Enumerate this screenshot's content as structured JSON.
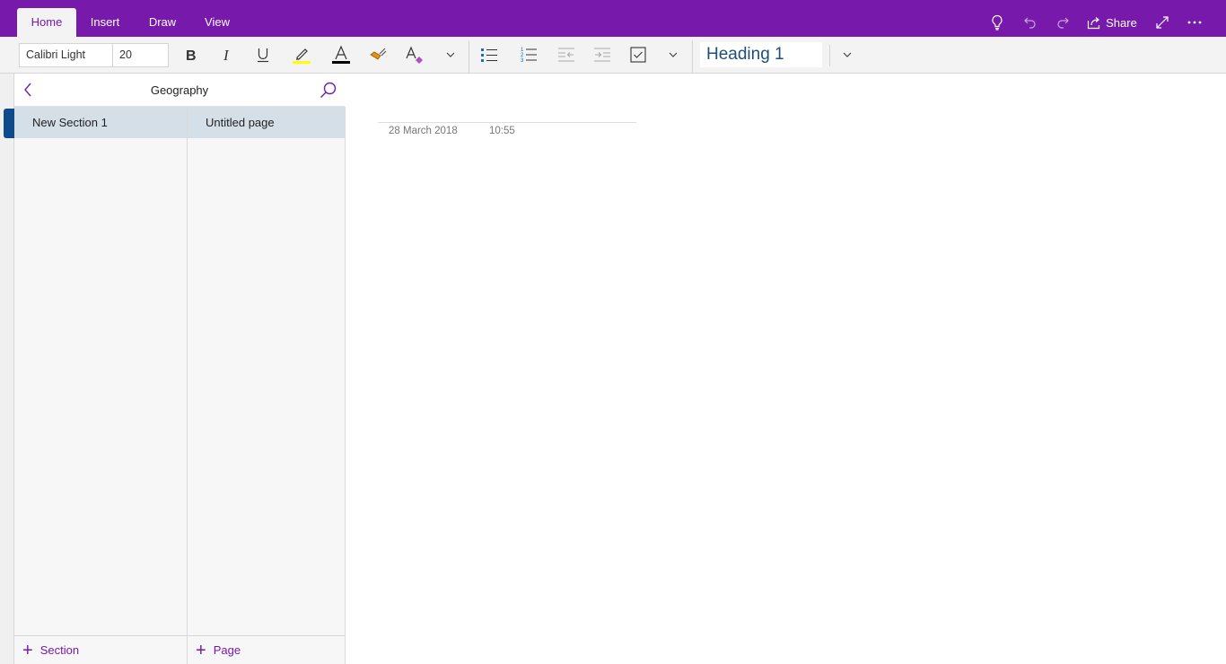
{
  "app": {
    "accent_color": "#7719aa",
    "selected_item_color": "#d5dfe8",
    "section_indicator_color": "#0f4a8a"
  },
  "tabs": [
    {
      "label": "Home",
      "active": true
    },
    {
      "label": "Insert",
      "active": false
    },
    {
      "label": "Draw",
      "active": false
    },
    {
      "label": "View",
      "active": false
    }
  ],
  "titlebar_actions": {
    "tell_me_icon": "lightbulb-icon",
    "undo_icon": "undo-icon",
    "redo_icon": "redo-icon",
    "share_label": "Share",
    "fullscreen_icon": "expand-icon",
    "more_icon": "more-icon"
  },
  "ribbon": {
    "font_name": "Calibri Light",
    "font_size": "20",
    "highlight_color": "#ffff00",
    "font_color": "#000000",
    "paragraph_style": "Heading 1",
    "buttons": [
      "bold",
      "italic",
      "underline",
      "highlight",
      "font-color",
      "format-painter",
      "clear-formatting",
      "more-text",
      "bulleted-list",
      "numbered-list",
      "decrease-indent",
      "increase-indent",
      "todo-tag",
      "more-paragraph",
      "more-styles"
    ]
  },
  "navigation": {
    "notebook_title": "Geography",
    "sections": [
      {
        "label": "New Section 1",
        "selected": true
      }
    ],
    "pages": [
      {
        "label": "Untitled page",
        "selected": true
      }
    ],
    "add_section_label": "Section",
    "add_page_label": "Page"
  },
  "page": {
    "title": "",
    "date": "28 March 2018",
    "time": "10:55"
  }
}
